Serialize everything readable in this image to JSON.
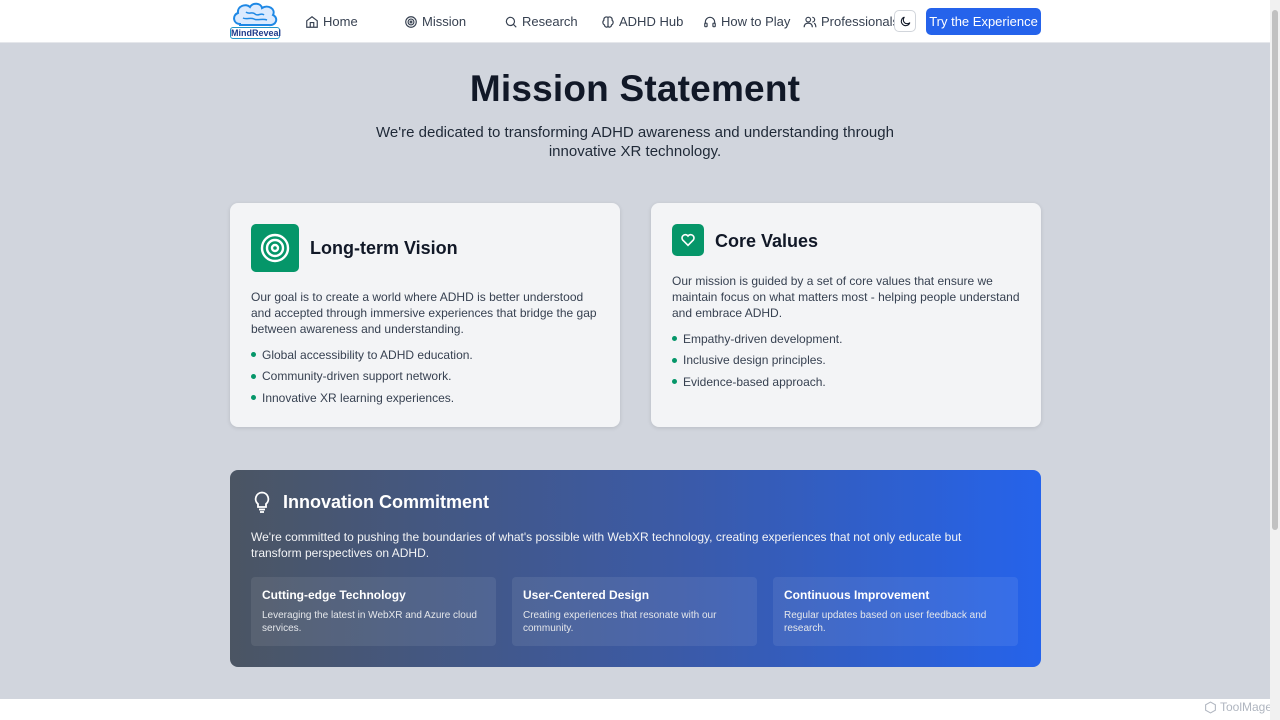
{
  "nav": {
    "logo_text": "MindReveal",
    "items": [
      {
        "label": "Home",
        "icon": "home-icon"
      },
      {
        "label": "Mission",
        "icon": "target-icon"
      },
      {
        "label": "Research",
        "icon": "search-icon"
      },
      {
        "label": "ADHD Hub",
        "icon": "brain-icon"
      },
      {
        "label": "How to Play",
        "icon": "headphones-icon"
      },
      {
        "label": "Professionals",
        "icon": "users-icon"
      }
    ],
    "theme_icon": "moon-icon",
    "cta_label": "Try the Experience"
  },
  "hero": {
    "title": "Mission Statement",
    "subtitle": "We're dedicated to transforming ADHD awareness and understanding through innovative XR technology."
  },
  "vision_card": {
    "title": "Long-term Vision",
    "icon": "target-icon",
    "text": "Our goal is to create a world where ADHD is better understood and accepted through immersive experiences that bridge the gap between awareness and understanding.",
    "bullets": [
      "Global accessibility to ADHD education.",
      "Community-driven support network.",
      "Innovative XR learning experiences."
    ]
  },
  "values_card": {
    "title": "Core Values",
    "icon": "heart-icon",
    "text": "Our mission is guided by a set of core values that ensure we maintain focus on what matters most - helping people understand and embrace ADHD.",
    "bullets": [
      "Empathy-driven development.",
      "Inclusive design principles.",
      "Evidence-based approach."
    ]
  },
  "innovation": {
    "title": "Innovation Commitment",
    "icon": "lightbulb-icon",
    "text": "We're committed to pushing the boundaries of what's possible with WebXR technology, creating experiences that not only educate but transform perspectives on ADHD.",
    "features": [
      {
        "title": "Cutting-edge Technology",
        "desc": "Leveraging the latest in WebXR and Azure cloud services."
      },
      {
        "title": "User-Centered Design",
        "desc": "Creating experiences that resonate with our community."
      },
      {
        "title": "Continuous Improvement",
        "desc": "Regular updates based on user feedback and research."
      }
    ]
  },
  "watermark": "ToolMage",
  "colors": {
    "accent": "#2563eb",
    "green": "#059669",
    "page_bg": "#d1d5dd"
  }
}
